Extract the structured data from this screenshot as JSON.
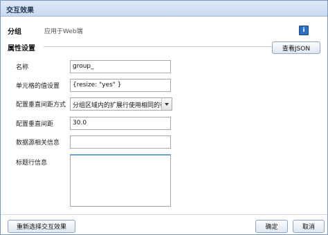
{
  "dialog": {
    "title": "交互效果"
  },
  "group": {
    "label": "分组",
    "description": "应用于Web端",
    "info_icon": "i"
  },
  "section": {
    "label": "属性设置",
    "view_json_label": "查看JSON"
  },
  "form": {
    "name": {
      "label": "名称",
      "value": "group_"
    },
    "cell_value": {
      "label": "单元格的值设置",
      "value": "{resize: \"yes\" }"
    },
    "spacing_mode": {
      "label": "配置垂直间距方式",
      "value": "分组区域内的扩展行使用相同的行"
    },
    "spacing": {
      "label": "配置垂直间距",
      "value": "30.0"
    },
    "datasource": {
      "label": "数据源相关信息",
      "value": ""
    },
    "header_info": {
      "label": "标题行信息",
      "value": ""
    }
  },
  "footer": {
    "reselect_label": "重新选择交互效果",
    "ok_label": "确定",
    "cancel_label": "取消"
  }
}
